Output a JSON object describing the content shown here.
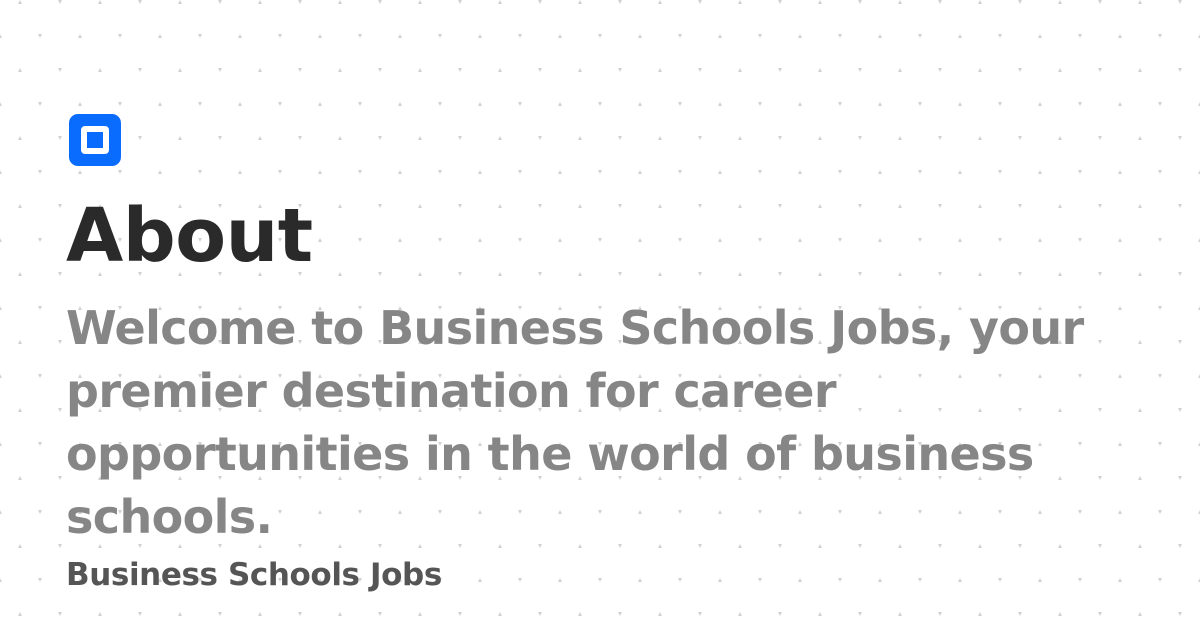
{
  "title": "About",
  "description": "Welcome to Business Schools Jobs, your premier destination for career opportunities in the world of business schools.",
  "site_name": "Business Schools Jobs",
  "icon": "square-logo-icon",
  "colors": {
    "brand": "#0a6cff",
    "title": "#2a2a2a",
    "description": "#868686",
    "site_name": "#555555",
    "background": "#ffffff",
    "pattern": "#d2d2d2"
  }
}
